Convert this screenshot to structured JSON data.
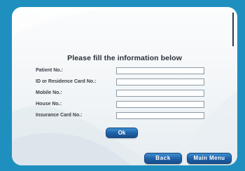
{
  "colors": {
    "frame_blue": "#1f8fbf",
    "panel": "#f4f7f9",
    "button_blue": "#1f5fa6",
    "button_text": "#ffffff"
  },
  "form": {
    "title": "Please fill the information below",
    "fields": [
      {
        "label": "Patient No.:",
        "value": ""
      },
      {
        "label": "ID or Residence Card No.:",
        "value": ""
      },
      {
        "label": "Mobile No.:",
        "value": ""
      },
      {
        "label": "House No.:",
        "value": ""
      },
      {
        "label": "Insurance Card No.:",
        "value": ""
      }
    ]
  },
  "buttons": {
    "ok": "Ok",
    "back": "Back",
    "main_menu": "Main Menu"
  }
}
